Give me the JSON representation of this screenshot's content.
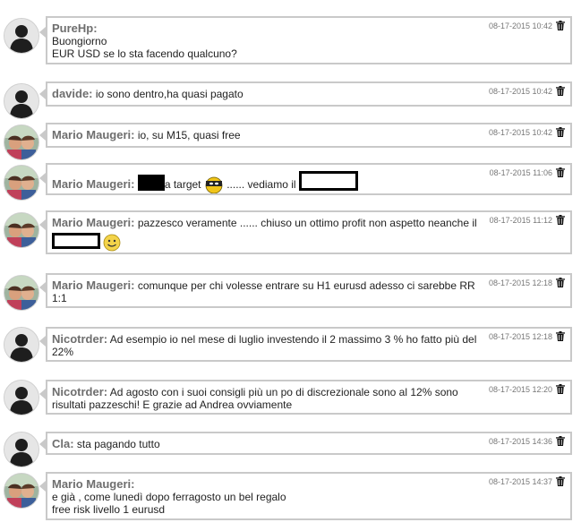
{
  "messages": [
    {
      "author": "PureHp:",
      "avatar": "person-placeholder",
      "lines": [
        "Buongiorno",
        "EUR USD se lo sta facendo qualcuno?"
      ],
      "date": "08-17-2015 10:42"
    },
    {
      "author": "davide:",
      "avatar": "person-placeholder",
      "text": "io sono dentro,ha quasi pagato",
      "date": "08-17-2015 10:42"
    },
    {
      "author": "Mario Maugeri:",
      "avatar": "photo",
      "text": "io, su M15, quasi free",
      "date": "08-17-2015 10:42"
    },
    {
      "author": "Mario Maugeri:",
      "avatar": "photo",
      "text_a": "a target",
      "text_b": "...... vediamo il",
      "date": "08-17-2015 11:06"
    },
    {
      "author": "Mario Maugeri:",
      "avatar": "photo",
      "text": "pazzesco veramente ...... chiuso un ottimo profit non aspetto neanche il",
      "date": "08-17-2015 11:12"
    },
    {
      "author": "Mario Maugeri:",
      "avatar": "photo",
      "text": "comunque per chi volesse entrare su H1 eurusd adesso ci sarebbe RR 1:1",
      "date": "08-17-2015 12:18"
    },
    {
      "author": "Nicotrder:",
      "avatar": "person-placeholder",
      "text": "Ad esempio io nel mese di luglio investendo il 2 massimo 3 % ho fatto più del 22%",
      "date": "08-17-2015 12:18"
    },
    {
      "author": "Nicotrder:",
      "avatar": "person-placeholder",
      "text": "Ad agosto con i suoi consigli più un po di discrezionale sono al 12% sono risultati pazzeschi! E grazie ad Andrea ovviamente",
      "date": "08-17-2015 12:20"
    },
    {
      "author": "Cla:",
      "avatar": "person-placeholder",
      "text": "sta pagando tutto",
      "date": "08-17-2015 14:36"
    },
    {
      "author": "Mario Maugeri:",
      "avatar": "photo",
      "lines": [
        "e già , come lunedì dopo ferragosto un bel regalo",
        "free risk livello 1 eurusd"
      ],
      "date": "08-17-2015 14:37"
    }
  ],
  "colors": {
    "border": "#c9c9c9",
    "author": "#6e6e6e",
    "meta": "#777777"
  },
  "icons": {
    "delete": "trash-icon",
    "placeholder": "person-silhouette-icon",
    "emoji_ninja": "ninja-emoji-icon",
    "emoji_smile": "smile-emoji-icon"
  }
}
